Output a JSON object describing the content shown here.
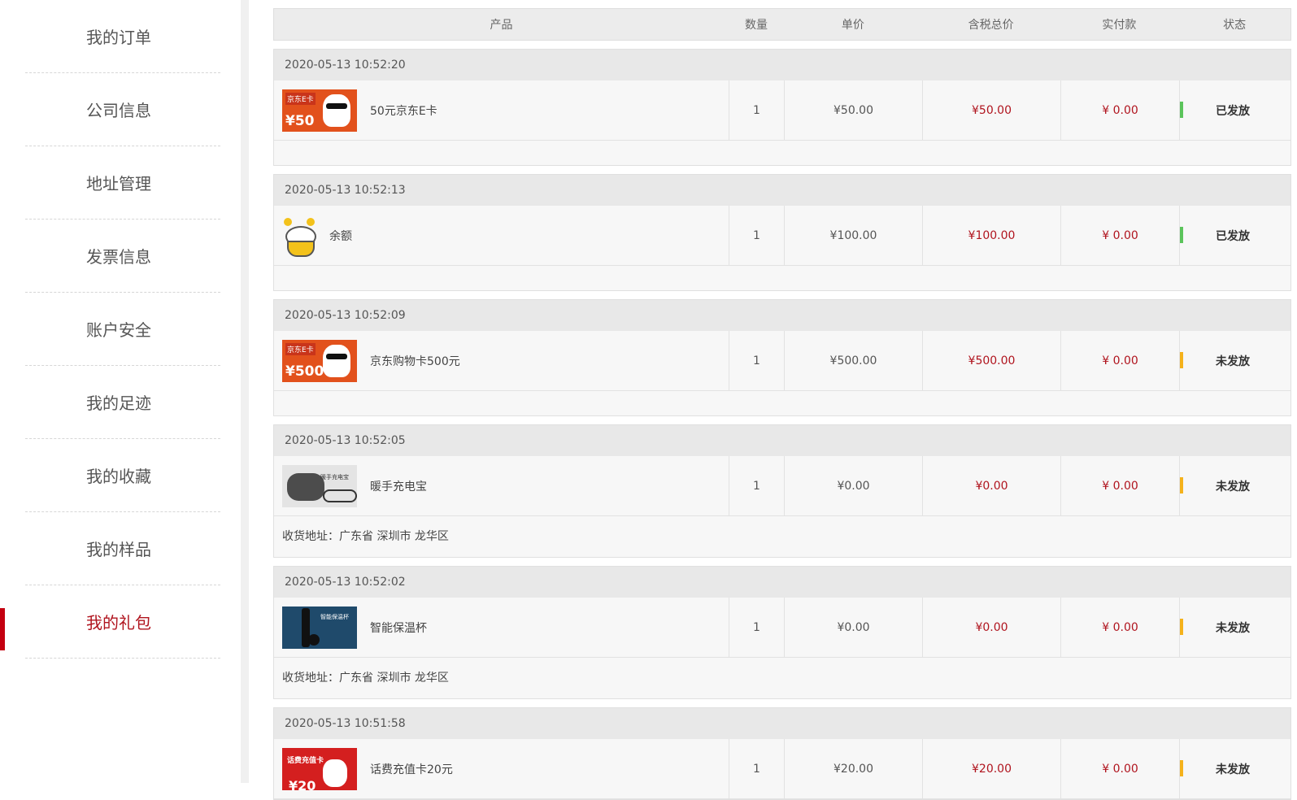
{
  "sidebar": {
    "items": [
      {
        "label": "我的订单",
        "icon": "chevron-right-icon"
      },
      {
        "label": "公司信息",
        "icon": "chevron-right-icon"
      },
      {
        "label": "地址管理",
        "icon": "chevron-right-icon"
      },
      {
        "label": "发票信息",
        "icon": "chevron-right-icon"
      },
      {
        "label": "账户安全",
        "icon": "chevron-right-icon"
      },
      {
        "label": "我的足迹",
        "icon": "chevron-right-icon"
      },
      {
        "label": "我的收藏",
        "icon": "chevron-right-icon"
      },
      {
        "label": "我的样品",
        "icon": "chevron-right-icon"
      },
      {
        "label": "我的礼包",
        "icon": "chevron-right-icon",
        "active": true
      }
    ]
  },
  "table": {
    "headers": {
      "product": "产品",
      "quantity": "数量",
      "unit_price": "单价",
      "total_with_tax": "含税总价",
      "paid": "实付款",
      "status": "状态"
    },
    "orders": [
      {
        "time": "2020-05-13 10:52:20",
        "product": "50元京东E卡",
        "thumb": {
          "tag": "京东E卡",
          "amount": "¥50"
        },
        "quantity": "1",
        "unit_price": "¥50.00",
        "total": "¥50.00",
        "paid": "¥ 0.00",
        "status": "已发放",
        "status_color": "#5bc45b",
        "address": ""
      },
      {
        "time": "2020-05-13 10:52:13",
        "product": "余额",
        "quantity": "1",
        "unit_price": "¥100.00",
        "total": "¥100.00",
        "paid": "¥ 0.00",
        "status": "已发放",
        "status_color": "#5bc45b",
        "address": ""
      },
      {
        "time": "2020-05-13 10:52:09",
        "product": "京东购物卡500元",
        "thumb": {
          "tag": "京东E卡",
          "amount": "¥500"
        },
        "quantity": "1",
        "unit_price": "¥500.00",
        "total": "¥500.00",
        "paid": "¥ 0.00",
        "status": "未发放",
        "status_color": "#f5b21b",
        "address": ""
      },
      {
        "time": "2020-05-13 10:52:05",
        "product": "暖手充电宝",
        "thumb": {
          "tag": "暖手充电宝"
        },
        "quantity": "1",
        "unit_price": "¥0.00",
        "total": "¥0.00",
        "paid": "¥ 0.00",
        "status": "未发放",
        "status_color": "#f5b21b",
        "address": "收货地址：广东省 深圳市 龙华区"
      },
      {
        "time": "2020-05-13 10:52:02",
        "product": "智能保温杯",
        "thumb": {
          "tag": "智能保温杯"
        },
        "quantity": "1",
        "unit_price": "¥0.00",
        "total": "¥0.00",
        "paid": "¥ 0.00",
        "status": "未发放",
        "status_color": "#f5b21b",
        "address": "收货地址：广东省 深圳市 龙华区"
      },
      {
        "time": "2020-05-13 10:51:58",
        "product": "话费充值卡20元",
        "thumb": {
          "tag": "话费充值卡",
          "amount": "¥20"
        },
        "quantity": "1",
        "unit_price": "¥20.00",
        "total": "¥20.00",
        "paid": "¥ 0.00",
        "status": "未发放",
        "status_color": "#f5b21b",
        "address": ""
      }
    ]
  },
  "colors": {
    "accent": "#b0141e",
    "active_bar": "#c40010",
    "issued": "#5bc45b",
    "pending": "#f5b21b"
  }
}
